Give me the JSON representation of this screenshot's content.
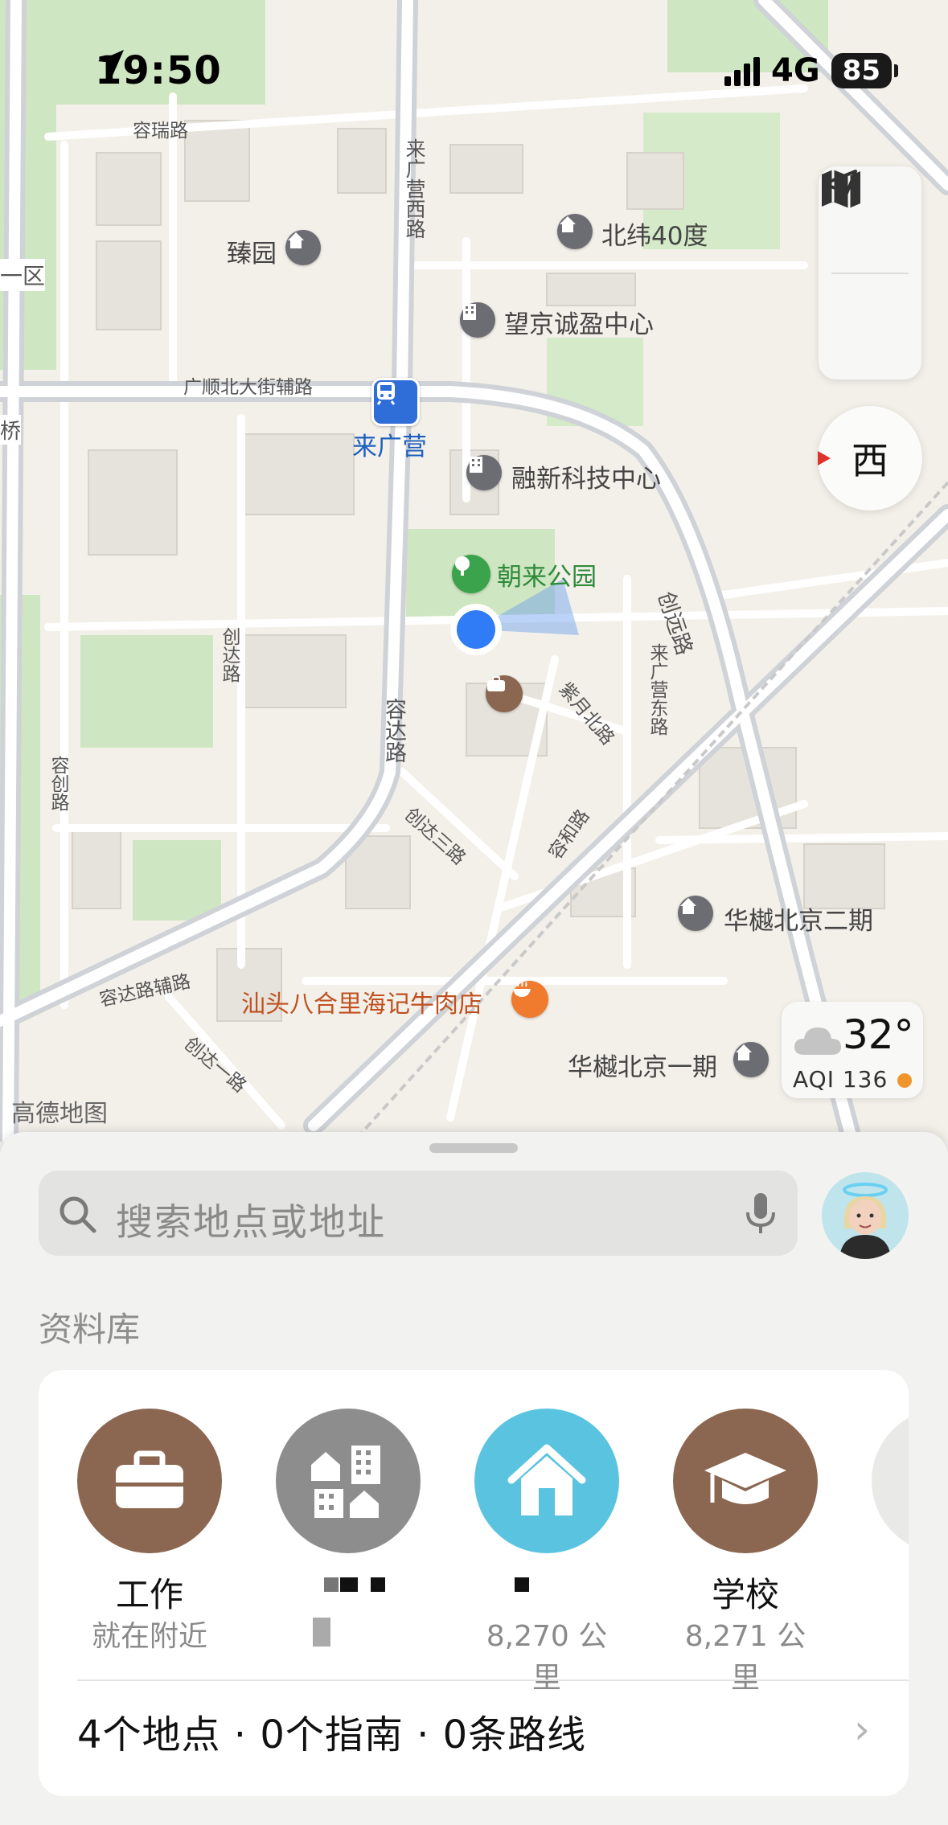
{
  "status_bar": {
    "time": "19:50",
    "network": "4G",
    "battery": "85"
  },
  "map": {
    "compass_label": "西",
    "attribution": "高德地图",
    "weather": {
      "temperature": "32°",
      "aqi": "AQI 136"
    },
    "pois": {
      "zhenyuan": "臻园",
      "beiwei": "北纬40度",
      "wangjing": "望京诚盈中心",
      "station": "来广营",
      "rongxin": "融新科技中心",
      "park": "朝来公园",
      "restaurant": "汕头八合里海记牛肉店",
      "huashu2": "华樾北京二期",
      "huashu1": "华樾北京一期"
    },
    "roads": {
      "rongrui": "容瑞路",
      "laiguangying_xi": "来广营西路",
      "guangshun": "广顺北大街辅路",
      "chuangda": "创达路",
      "rongda": "容达路",
      "chuangyuan": "创远路",
      "laiguangying_dong": "来广营东路",
      "ziyue": "紫月北路",
      "chuangda3": "创达三路",
      "ronghe": "容和路",
      "rongchuang": "容创路",
      "rongda_fu": "容达路辅路",
      "chuangda1": "创达一路",
      "edge_qu": "一区",
      "edge_qiao": "桥"
    }
  },
  "sheet": {
    "search_placeholder": "搜索地点或地址",
    "library_title": "资料库",
    "favorites": [
      {
        "name": "工作",
        "detail": "就在附近",
        "color": "#8b6650"
      },
      {
        "name": "",
        "detail": "",
        "color": "#8d8d8d"
      },
      {
        "name": "",
        "detail": "8,270 公里",
        "color": "#5ac4e0"
      },
      {
        "name": "学校",
        "detail": "8,271 公里",
        "color": "#8b6650"
      }
    ],
    "summary": "4个地点 · 0个指南 · 0条路线"
  }
}
